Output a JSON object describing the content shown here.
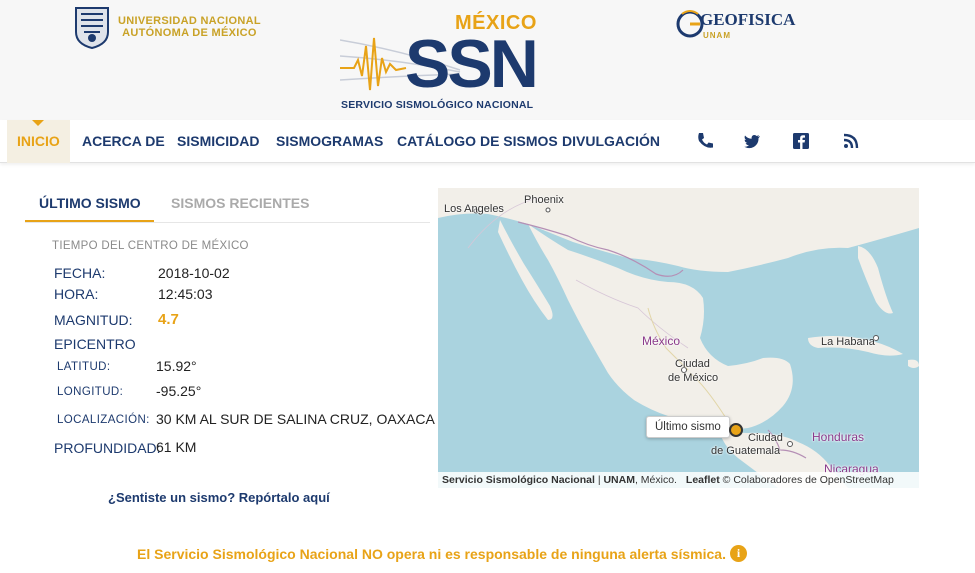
{
  "header": {
    "unam_line1": "UNIVERSIDAD NACIONAL",
    "unam_line2": "AUTÓNOMA DE MÉXICO",
    "ssn_country": "MÉXICO",
    "ssn_acronym": "SSN",
    "ssn_name": "SERVICIO SISMOLÓGICO NACIONAL",
    "geo_name": "GEOFISICA",
    "geo_sub": "UNAM"
  },
  "nav": {
    "items": [
      {
        "label": "INICIO",
        "active": true
      },
      {
        "label": "ACERCA DE"
      },
      {
        "label": "SISMICIDAD"
      },
      {
        "label": "SISMOGRAMAS"
      },
      {
        "label": "CATÁLOGO DE SISMOS"
      },
      {
        "label": "DIVULGACIÓN"
      }
    ],
    "icons": [
      "phone-icon",
      "twitter-icon",
      "facebook-icon",
      "rss-icon"
    ]
  },
  "tabs": [
    {
      "label": "ÚLTIMO SISMO",
      "active": true
    },
    {
      "label": "SISMOS RECIENTES",
      "active": false
    }
  ],
  "quake": {
    "time_label": "TIEMPO DEL CENTRO DE MÉXICO",
    "fecha_label": "FECHA:",
    "fecha": "2018-10-02",
    "hora_label": "HORA:",
    "hora": "12:45:03",
    "magnitud_label": "MAGNITUD:",
    "magnitud": "4.7",
    "epicentro_label": "EPICENTRO",
    "latitud_label": "LATITUD:",
    "latitud": "15.92°",
    "longitud_label": "LONGITUD:",
    "longitud": "-95.25°",
    "localizacion_label": "LOCALIZACIÓN:",
    "localizacion": "30 KM AL SUR DE SALINA CRUZ, OAXACA",
    "profundidad_label": "PROFUNDIDAD:",
    "profundidad": "61 KM"
  },
  "report_link": "¿Sentiste un sismo? Repórtalo aquí",
  "map": {
    "labels": {
      "phoenix": "Phoenix",
      "los_angeles": "Los Angeles",
      "mexico": "México",
      "ciudad_mexico_1": "Ciudad",
      "ciudad_mexico_2": "de México",
      "la_habana": "La Habana",
      "ciudad_guatemala_1": "Ciudad",
      "ciudad_guatemala_2": "de Guatemala",
      "honduras": "Honduras",
      "nicaragua": "Nicaragua"
    },
    "tooltip": "Último sismo",
    "attrib_ssn": "Servicio Sismológico Nacional",
    "attrib_unam": "UNAM",
    "attrib_mexico": ", México.",
    "attrib_leaflet": "Leaflet",
    "attrib_osm": "© Colaboradores de OpenStreetMap",
    "colors": {
      "water": "#aad3df",
      "land": "#f2efe9",
      "border": "#b58fb5",
      "marker": "#e8a317"
    }
  },
  "alert": {
    "before": "El Servicio Sismológico Nacional ",
    "no": "NO",
    "after": " opera ni es responsable de ninguna alerta sísmica."
  },
  "colors": {
    "brand_blue": "#1d3a6e",
    "brand_gold": "#e8a317"
  }
}
